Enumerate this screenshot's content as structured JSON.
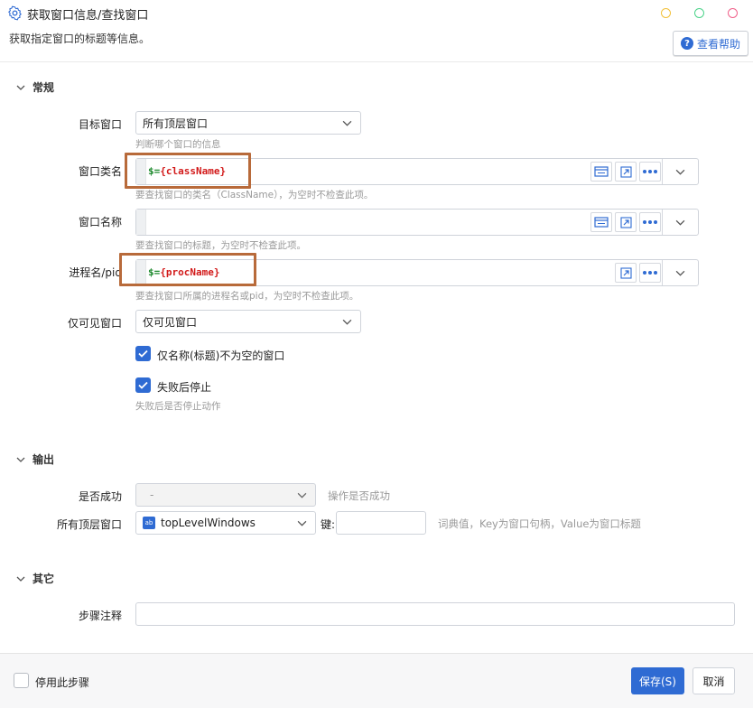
{
  "header": {
    "title": "获取窗口信息/查找窗口",
    "subtitle": "获取指定窗口的标题等信息。",
    "help_label": "查看帮助",
    "help_icon": "?",
    "dot_colors": [
      "#f2c038",
      "#4cd38a",
      "#f0608a"
    ]
  },
  "sections": {
    "general": "常规",
    "output": "输出",
    "other": "其它"
  },
  "general": {
    "target_window": {
      "label": "目标窗口",
      "value": "所有顶层窗口",
      "hint": "判断哪个窗口的信息"
    },
    "class_name": {
      "label": "窗口类名",
      "dollar": "$=",
      "var": "{className}",
      "hint": "要查找窗口的类名（ClassName），为空时不检查此项。"
    },
    "window_name": {
      "label": "窗口名称",
      "hint": "要查找窗口的标题，为空时不检查此项。"
    },
    "process": {
      "label": "进程名/pid",
      "dollar": "$=",
      "var": "{procName}",
      "hint": "要查找窗口所属的进程名或pid，为空时不检查此项。"
    },
    "visible_only": {
      "label": "仅可见窗口",
      "value": "仅可见窗口"
    },
    "nonempty_title": {
      "label": "仅名称(标题)不为空的窗口",
      "checked": true
    },
    "stop_on_fail": {
      "label": "失败后停止",
      "checked": true,
      "hint": "失败后是否停止动作"
    }
  },
  "output": {
    "success": {
      "label": "是否成功",
      "value": "-",
      "hint": "操作是否成功"
    },
    "windows": {
      "label": "所有顶层窗口",
      "value": "topLevelWindows",
      "icon_text": "ab",
      "key_label": "键:",
      "key_value": "",
      "hint": "词典值，Key为窗口句柄，Value为窗口标题"
    }
  },
  "other": {
    "comment": {
      "label": "步骤注释",
      "value": ""
    }
  },
  "footer": {
    "disable_label": "停用此步骤",
    "save_label": "保存(S)",
    "cancel_label": "取消"
  },
  "colors": {
    "accent": "#2f6bd3",
    "highlight": "#b86a3a",
    "expr_dollar": "#1e8a2e",
    "expr_var": "#d21a1a"
  }
}
